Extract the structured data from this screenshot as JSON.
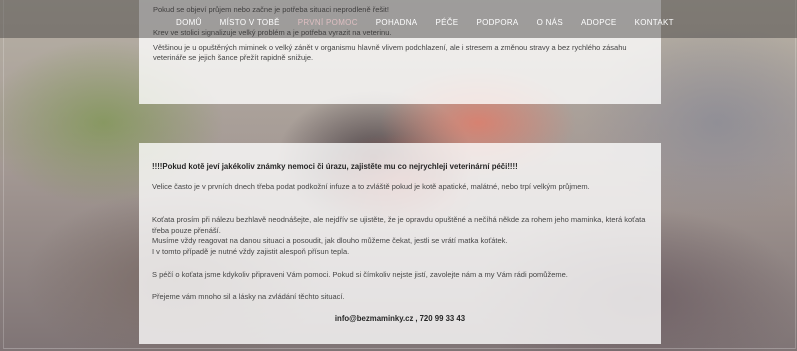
{
  "nav": {
    "items": [
      {
        "label": "DOMŮ"
      },
      {
        "label": "MÍSTO V TOBĚ"
      },
      {
        "label": "PRVNÍ POMOC",
        "active": true
      },
      {
        "label": "POHADNA"
      },
      {
        "label": "PÉČE"
      },
      {
        "label": "PODPORA"
      },
      {
        "label": "O NÁS"
      },
      {
        "label": "ADOPCE"
      },
      {
        "label": "KONTAKT"
      }
    ]
  },
  "top_panel": {
    "line1": "Pokud se objeví průjem nebo začne je potřeba situaci neprodleně řešit!",
    "line2": "Krev ve stolici signalizuje velký problém a je potřeba vyrazit na veterinu.",
    "line3": "Většinou je u opuštěných miminek o velký zánět v organismu hlavně vlivem podchlazení, ale i stresem a změnou stravy a bez rychlého zásahu veterináře se jejich šance přežít rapidně snižuje."
  },
  "main_panel": {
    "heading": "!!!!Pokud kotě jeví jakékoliv známky nemoci či úrazu, zajistěte mu co nejrychleji veterinární péči!!!!",
    "p1": "Velice často je v prvních dnech třeba podat podkožní infuze a to zvláště pokud je kotě apatické, malátné, nebo trpí  velkým průjmem.",
    "p2a": "Koťata prosím při nálezu bezhlavě neodnášejte, ale nejdřív se ujistěte, že je opravdu opuštěné a nečíhá někde za rohem jeho maminka, která koťata třeba pouze přenáší.",
    "p2b": "Musíme vždy reagovat na danou situaci a posoudit, jak dlouho můžeme čekat, jestli se vrátí matka koťátek.",
    "p2c": "I v tomto případě je nutné vždy zajistit alespoň přísun tepla.",
    "p3": "S péčí o koťata jsme kdykoliv připraveni Vám pomoci. Pokud si čímkoliv nejste jistí, zavolejte nám a my Vám rádi pomůžeme.",
    "p4": "Přejeme vám mnoho sil a lásky na zvládání těchto situací.",
    "email": "info@bezmaminky.cz",
    "phone": "720 99 33 43"
  }
}
